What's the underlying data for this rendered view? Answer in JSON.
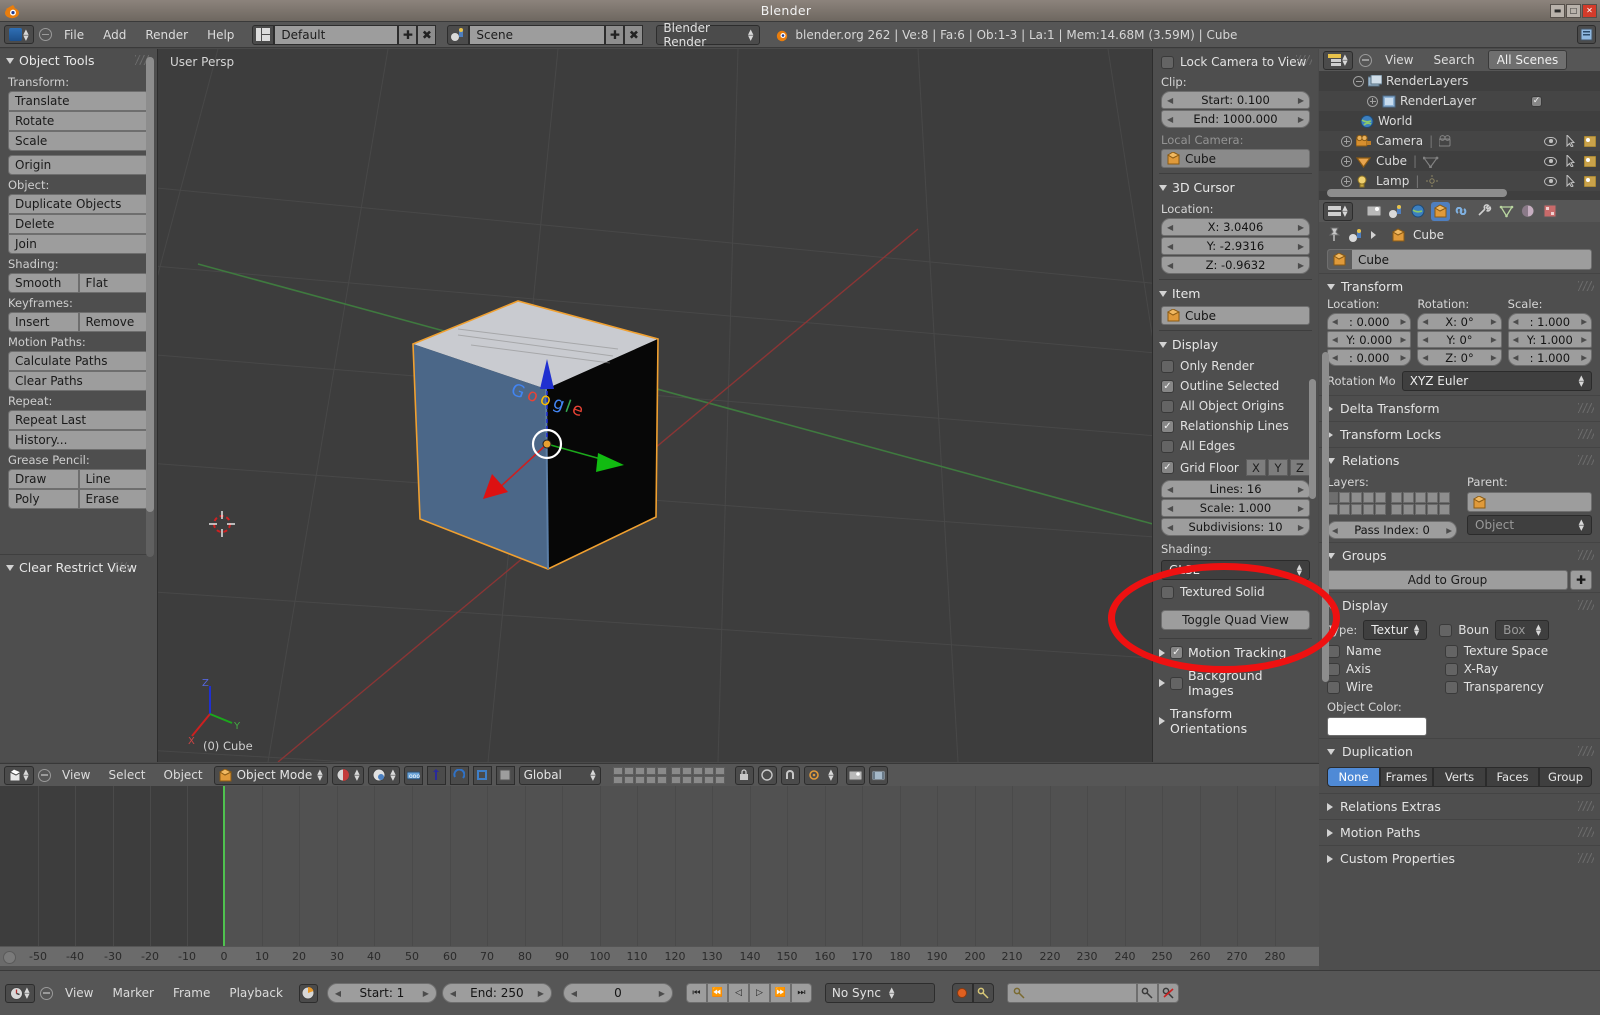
{
  "window": {
    "title": "Blender",
    "buttons": [
      "minimize-button",
      "maximize-button",
      "close-button"
    ],
    "min_glyph": "▬",
    "max_glyph": "□",
    "close_glyph": "✕"
  },
  "info_header": {
    "menus": [
      "File",
      "Add",
      "Render",
      "Help"
    ],
    "screen_layout": "Default",
    "scene": "Scene",
    "engine": "Blender Render",
    "stats": "blender.org 262 | Ve:8 | Fa:6 | Ob:1-3 | La:1 | Mem:14.68M (3.59M) | Cube",
    "add_glyph": "✚",
    "unlink_glyph": "✖"
  },
  "toolshelf": {
    "title": "Object Tools",
    "sections": [
      {
        "label": "Transform:",
        "buttons": [
          "Translate",
          "Rotate",
          "Scale"
        ]
      },
      {
        "label": "",
        "buttons": [
          "Origin"
        ]
      },
      {
        "label": "Object:",
        "buttons": [
          "Duplicate Objects",
          "Delete",
          "Join"
        ]
      },
      {
        "label": "Shading:",
        "row": [
          "Smooth",
          "Flat"
        ]
      },
      {
        "label": "Keyframes:",
        "row": [
          "Insert",
          "Remove"
        ]
      },
      {
        "label": "Motion Paths:",
        "buttons": [
          "Calculate Paths",
          "Clear Paths"
        ]
      },
      {
        "label": "Repeat:",
        "buttons": [
          "Repeat Last",
          "History..."
        ]
      },
      {
        "label": "Grease Pencil:",
        "row2": [
          [
            "Draw",
            "Line"
          ],
          [
            "Poly",
            "Erase"
          ]
        ]
      }
    ],
    "bottom_panel": "Clear Restrict View"
  },
  "viewport": {
    "persp_label": "User Persp",
    "object_label": "(0) Cube",
    "axis_x": "X",
    "axis_y": "Y",
    "axis_z": "Z"
  },
  "npanel": {
    "lock_camera": "Lock Camera to View",
    "clip_label": "Clip:",
    "clip_start": "Start: 0.100",
    "clip_end": "End: 1000.000",
    "local_camera_label": "Local Camera:",
    "local_camera_value": "Cube",
    "cursor_panel": "3D Cursor",
    "location_label": "Location:",
    "cursor_x": "X: 3.0406",
    "cursor_y": "Y: -2.9316",
    "cursor_z": "Z: -0.9632",
    "item_panel": "Item",
    "item_name": "Cube",
    "display_panel": "Display",
    "only_render": "Only Render",
    "outline_selected": "Outline Selected",
    "all_object_origins": "All Object Origins",
    "relationship_lines": "Relationship Lines",
    "all_edges": "All Edges",
    "grid_floor": "Grid Floor",
    "grid_axes": [
      "X",
      "Y",
      "Z"
    ],
    "lines": "Lines: 16",
    "scale": "Scale: 1.000",
    "subdivisions": "Subdivisions: 10",
    "shading_label": "Shading:",
    "shading_value": "GLSL",
    "textured_solid": "Textured Solid",
    "toggle_quad_view": "Toggle Quad View",
    "motion_tracking": "Motion Tracking",
    "background_images": "Background Images",
    "transform_orientations": "Transform Orientations"
  },
  "outliner": {
    "view": "View",
    "search": "Search",
    "filter": "All Scenes",
    "rows": [
      {
        "name": "RenderLayers",
        "indent": 1,
        "icon": "renderlayers-icon",
        "expand": "minus",
        "checkbox": false,
        "vis": false
      },
      {
        "name": "RenderLayer",
        "indent": 2,
        "icon": "renderlayer-icon",
        "expand": "plus",
        "checkbox": true,
        "vis": false
      },
      {
        "name": "World",
        "indent": 1,
        "icon": "world-icon",
        "expand": "none",
        "checkbox": false,
        "vis": false
      },
      {
        "name": "Camera",
        "indent": 0,
        "icon": "camera-icon",
        "expand": "plus",
        "checkbox": false,
        "vis": true
      },
      {
        "name": "Cube",
        "indent": 0,
        "icon": "mesh-icon",
        "expand": "plus",
        "checkbox": false,
        "vis": true
      },
      {
        "name": "Lamp",
        "indent": 0,
        "icon": "lamp-icon",
        "expand": "plus",
        "checkbox": false,
        "vis": true
      }
    ]
  },
  "properties": {
    "tabs": [
      "render-tab",
      "scene-tab",
      "world-tab",
      "object-tab",
      "constraints-tab",
      "modifiers-tab",
      "data-tab",
      "material-tab",
      "texture-tab"
    ],
    "active_tab_index": 3,
    "breadcrumb_scene": "",
    "breadcrumb_object": "Cube",
    "name_value": "Cube",
    "transform": {
      "title": "Transform",
      "location_label": "Location:",
      "rotation_label": "Rotation:",
      "scale_label": "Scale:",
      "location": [
        ": 0.000",
        "Y: 0.000",
        ": 0.000"
      ],
      "rotation": [
        "X: 0°",
        "Y: 0°",
        "Z: 0°"
      ],
      "scale": [
        ": 1.000",
        "Y: 1.000",
        ": 1.000"
      ],
      "rotation_mode_label": "Rotation Mo",
      "rotation_mode_value": "XYZ Euler"
    },
    "delta_transform": "Delta Transform",
    "transform_locks": "Transform Locks",
    "relations": {
      "title": "Relations",
      "layers_label": "Layers:",
      "parent_label": "Parent:",
      "parent_value": "",
      "parent_type": "Object",
      "pass_index": "Pass Index: 0"
    },
    "groups": {
      "title": "Groups",
      "add_to_group": "Add to Group",
      "add_glyph": "✚"
    },
    "display": {
      "title": "Display",
      "type_label": "Type:",
      "type_value": "Textur",
      "bounds_label": "Boun",
      "bounds_value": "Box",
      "checks_left": [
        "Name",
        "Axis",
        "Wire"
      ],
      "checks_right": [
        "Texture Space",
        "X-Ray",
        "Transparency"
      ],
      "object_color_label": "Object Color:",
      "object_color": "#ffffff"
    },
    "duplication": {
      "title": "Duplication",
      "options": [
        "None",
        "Frames",
        "Verts",
        "Faces",
        "Group"
      ],
      "selected": "None"
    },
    "relations_extras": "Relations Extras",
    "motion_paths": "Motion Paths",
    "custom_properties": "Custom Properties"
  },
  "viewport_header": {
    "menus": [
      "View",
      "Select",
      "Object"
    ],
    "mode": "Object Mode",
    "orientation": "Global"
  },
  "timeline": {
    "menus": [
      "View",
      "Marker",
      "Frame",
      "Playback"
    ],
    "start": "Start: 1",
    "end": "End: 250",
    "current_frame": "0",
    "sync_mode": "No Sync",
    "playhead_frame": 0,
    "ruler_ticks": [
      "-50",
      "-40",
      "-30",
      "-20",
      "-10",
      "0",
      "10",
      "20",
      "30",
      "40",
      "50",
      "60",
      "70",
      "80",
      "90",
      "100",
      "110",
      "120",
      "130",
      "140",
      "150",
      "160",
      "170",
      "180",
      "190",
      "200",
      "210",
      "220",
      "230",
      "240",
      "250",
      "260",
      "270",
      "280"
    ],
    "playback_glyphs": [
      "⏮",
      "⏪",
      "◁",
      "▷",
      "⏩",
      "⏭"
    ]
  },
  "annotation": {
    "shape": "red-ellipse",
    "color": "#ee1111",
    "target": "shading-glsl-dropdown"
  }
}
